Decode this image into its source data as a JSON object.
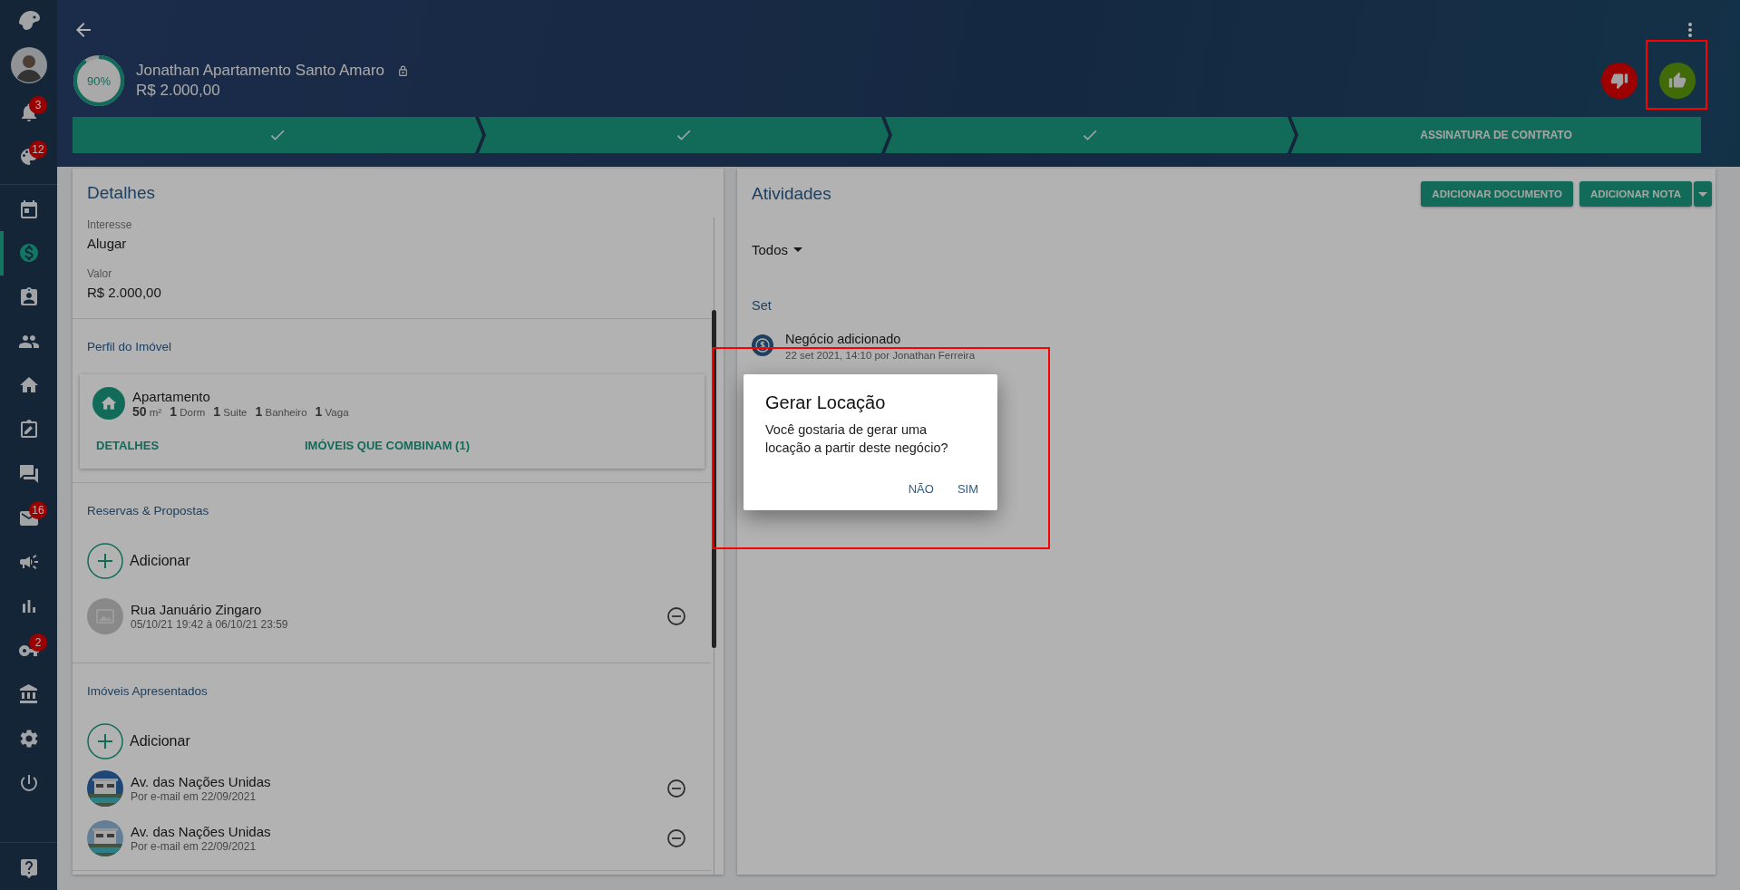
{
  "sidebar": {
    "sections": [
      {
        "items": [
          {
            "kind": "bell",
            "badge": "3",
            "selected": false
          },
          {
            "kind": "palette",
            "badge": "12",
            "selected": false
          }
        ]
      },
      {
        "items": [
          {
            "kind": "calendar",
            "selected": false
          },
          {
            "kind": "money",
            "selected": true
          },
          {
            "kind": "badge",
            "selected": false
          },
          {
            "kind": "people",
            "selected": false
          },
          {
            "kind": "home",
            "selected": false
          },
          {
            "kind": "clipboard",
            "selected": false
          },
          {
            "kind": "chat",
            "selected": false
          },
          {
            "kind": "mail",
            "badge": "16",
            "selected": false
          },
          {
            "kind": "megaphone",
            "selected": false
          },
          {
            "kind": "chart",
            "selected": false
          },
          {
            "kind": "key",
            "badge": "2",
            "selected": false
          },
          {
            "kind": "bank",
            "selected": false
          },
          {
            "kind": "gear",
            "selected": false
          },
          {
            "kind": "power",
            "selected": false
          }
        ]
      },
      {
        "items": [
          {
            "kind": "help",
            "selected": false
          }
        ]
      }
    ]
  },
  "header": {
    "progress": {
      "label": "90%",
      "level": 0.9
    },
    "title": "Jonathan Apartamento Santo Amaro",
    "locked": true,
    "price": "R$ 2.000,00",
    "actions": [
      {
        "kind": "lose",
        "highlighted": false
      },
      {
        "kind": "win",
        "highlighted": true
      }
    ],
    "steps": [
      {
        "done": true
      },
      {
        "done": true
      },
      {
        "done": true
      },
      {
        "done": false,
        "label": "ASSINATURA DE CONTRATO"
      }
    ]
  },
  "details": {
    "title": "Detalhes",
    "fields": [
      {
        "label": "Interesse",
        "value": "Alugar"
      },
      {
        "label": "Valor",
        "value": "R$ 2.000,00"
      }
    ],
    "property_profile": {
      "title": "Perfil do Imóvel",
      "type": "Apartamento",
      "features": [
        {
          "count": "50",
          "unit": "m²"
        },
        {
          "count": "1",
          "unit": "Dorm"
        },
        {
          "count": "1",
          "unit": "Suite"
        },
        {
          "count": "1",
          "unit": "Banheiro"
        },
        {
          "count": "1",
          "unit": "Vaga"
        }
      ],
      "links": [
        "DETALHES",
        "IMÓVEIS QUE COMBINAM (1)"
      ]
    },
    "lists": [
      {
        "title": "Reservas & Propostas",
        "add": "Adicionar",
        "items": [
          {
            "kind": "placeholder",
            "title": "Rua Januário Zingaro",
            "subtitle": "05/10/21 19:42 à 06/10/21 23:59"
          }
        ]
      },
      {
        "title": "Imóveis Apresentados",
        "add": "Adicionar",
        "items": [
          {
            "kind": "picture",
            "title": "Av. das Nações Unidas",
            "subtitle": "Por e-mail em 22/09/2021"
          },
          {
            "kind": "picture",
            "title": "Av. das Nações Unidas",
            "subtitle": "Por e-mail em 22/09/2021"
          }
        ]
      }
    ]
  },
  "activities": {
    "title": "Atividades",
    "buttons": [
      "ADICIONAR DOCUMENTO",
      "ADICIONAR NOTA"
    ],
    "filter": "Todos",
    "groups": [
      {
        "label": "Set",
        "items": [
          {
            "title": "Negócio adicionado",
            "meta": "22 set 2021, 14:10 por Jonathan Ferreira"
          }
        ]
      }
    ]
  },
  "dialog": {
    "title": "Gerar Locação",
    "message": "Você gostaria de gerar uma locação a partir deste negócio?",
    "buttons": [
      "NÃO",
      "SIM"
    ],
    "highlighted": true
  }
}
